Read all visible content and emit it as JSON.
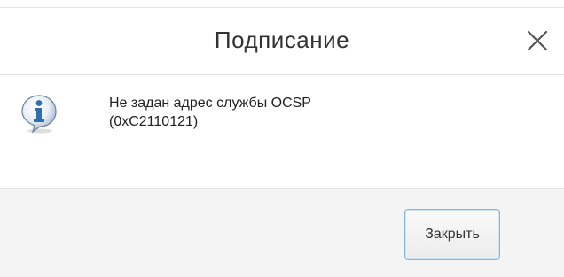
{
  "dialog": {
    "title": "Подписание",
    "close_icon": "close-icon",
    "message_icon": "info-icon",
    "message_line1": "Не задан адрес службы OCSP",
    "message_line2": "(0xC2110121)",
    "close_button_label": "Закрыть"
  },
  "colors": {
    "button_border": "#8ab4dc",
    "footer_background": "#f4f4f4",
    "info_icon_blue": "#2f6fb0"
  }
}
